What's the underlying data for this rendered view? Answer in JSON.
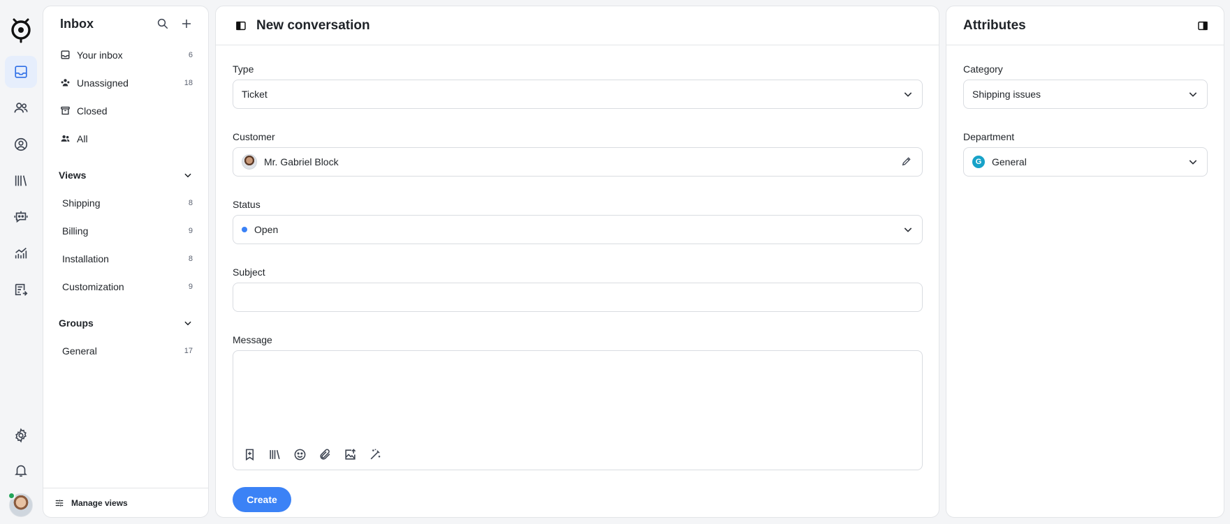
{
  "colors": {
    "accent": "#3b82f6",
    "status_open": "#3b82f6",
    "department_badge": "#17a2c8",
    "online": "#23a55a"
  },
  "rail": {
    "items": [
      {
        "name": "inbox-icon",
        "active": true
      },
      {
        "name": "contacts-icon",
        "active": false
      },
      {
        "name": "user-circle-icon",
        "active": false
      },
      {
        "name": "library-icon",
        "active": false
      },
      {
        "name": "bot-icon",
        "active": false
      },
      {
        "name": "reports-icon",
        "active": false
      },
      {
        "name": "assign-list-icon",
        "active": false
      }
    ],
    "bottom": [
      "settings-icon",
      "bell-icon",
      "avatar"
    ]
  },
  "sidebar": {
    "title": "Inbox",
    "items": [
      {
        "label": "Your inbox",
        "count": "6"
      },
      {
        "label": "Unassigned",
        "count": "18"
      },
      {
        "label": "Closed",
        "count": ""
      },
      {
        "label": "All",
        "count": ""
      }
    ],
    "views": {
      "title": "Views",
      "items": [
        {
          "label": "Shipping",
          "count": "8"
        },
        {
          "label": "Billing",
          "count": "9"
        },
        {
          "label": "Installation",
          "count": "8"
        },
        {
          "label": "Customization",
          "count": "9"
        }
      ]
    },
    "groups": {
      "title": "Groups",
      "items": [
        {
          "label": "General",
          "count": "17"
        }
      ]
    },
    "footer": "Manage views"
  },
  "main": {
    "title": "New conversation",
    "type": {
      "label": "Type",
      "value": "Ticket"
    },
    "customer": {
      "label": "Customer",
      "value": "Mr. Gabriel Block"
    },
    "status": {
      "label": "Status",
      "value": "Open"
    },
    "subject": {
      "label": "Subject",
      "value": ""
    },
    "message": {
      "label": "Message",
      "value": "",
      "toolbar": [
        "bookmark-add-icon",
        "library-icon",
        "emoji-icon",
        "attachment-icon",
        "image-upload-icon",
        "magic-wand-icon"
      ]
    },
    "create_label": "Create"
  },
  "attributes": {
    "title": "Attributes",
    "category": {
      "label": "Category",
      "value": "Shipping issues"
    },
    "department": {
      "label": "Department",
      "value": "General",
      "badge": "G"
    }
  }
}
